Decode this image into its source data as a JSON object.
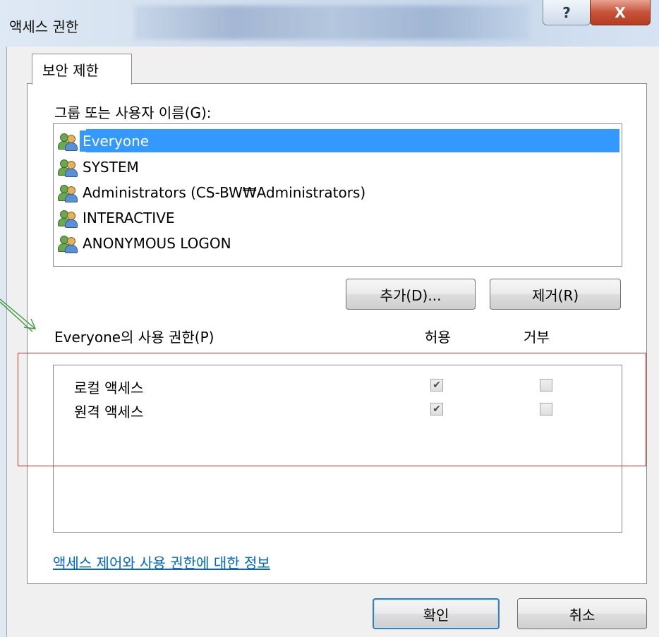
{
  "window": {
    "title": "액세스 권한"
  },
  "titlebar": {
    "help_glyph": "?",
    "close_glyph": "X"
  },
  "tab": {
    "label": "보안 제한"
  },
  "group_label": "그룹 또는 사용자 이름(G):",
  "users": [
    {
      "name": "Everyone",
      "selected": true
    },
    {
      "name": "SYSTEM",
      "selected": false
    },
    {
      "name": "Administrators (CS-BW₩Administrators)",
      "selected": false
    },
    {
      "name": "INTERACTIVE",
      "selected": false
    },
    {
      "name": "ANONYMOUS LOGON",
      "selected": false
    }
  ],
  "buttons": {
    "add": "추가(D)...",
    "remove": "제거(R)",
    "ok": "확인",
    "cancel": "취소"
  },
  "permissions": {
    "title": "Everyone의 사용 권한(P)",
    "allow_header": "허용",
    "deny_header": "거부",
    "rows": [
      {
        "name": "로컬 액세스",
        "allow": true,
        "deny": false
      },
      {
        "name": "원격 액세스",
        "allow": true,
        "deny": false
      }
    ]
  },
  "link": "액세스 제어와 사용 권한에 대한 정보",
  "icons": {
    "user": "users-group-icon",
    "arrow": "green-arrow-icon"
  },
  "colors": {
    "selection": "#3399ff",
    "highlight_box": "#d9302c",
    "link": "#0066cc",
    "arrow": "#3a9a3a"
  }
}
